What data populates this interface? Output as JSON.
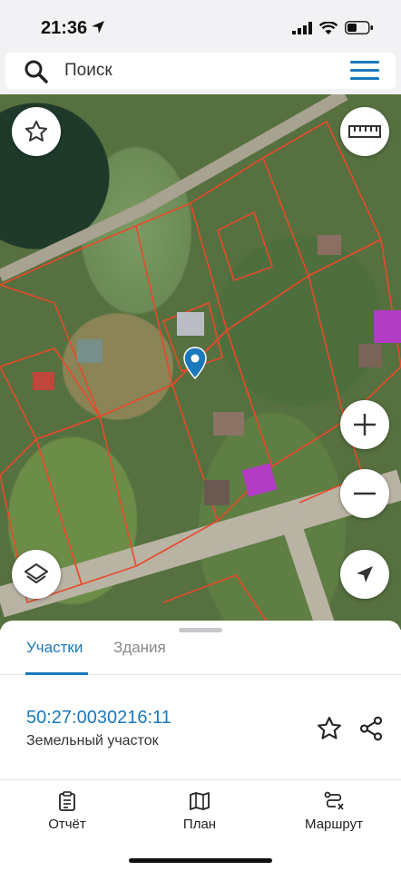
{
  "status_bar": {
    "time": "21:36"
  },
  "search": {
    "placeholder": "Поиск"
  },
  "map": {
    "buttons": [
      "star-icon",
      "ruler-icon",
      "zoom-in-icon",
      "zoom-out-icon",
      "layers-icon",
      "locate-icon"
    ]
  },
  "sheet": {
    "tabs": [
      {
        "label": "Участки",
        "active": true
      },
      {
        "label": "Здания",
        "active": false
      }
    ],
    "parcel": {
      "cadastral_number": "50:27:0030216:11",
      "type": "Земельный участок"
    }
  },
  "bottom_nav": [
    {
      "label": "Отчёт",
      "icon": "clipboard-icon"
    },
    {
      "label": "План",
      "icon": "map-icon"
    },
    {
      "label": "Маршрут",
      "icon": "route-icon"
    }
  ],
  "colors": {
    "accent": "#1a79bd",
    "parcel_border": "#e84a2a"
  }
}
